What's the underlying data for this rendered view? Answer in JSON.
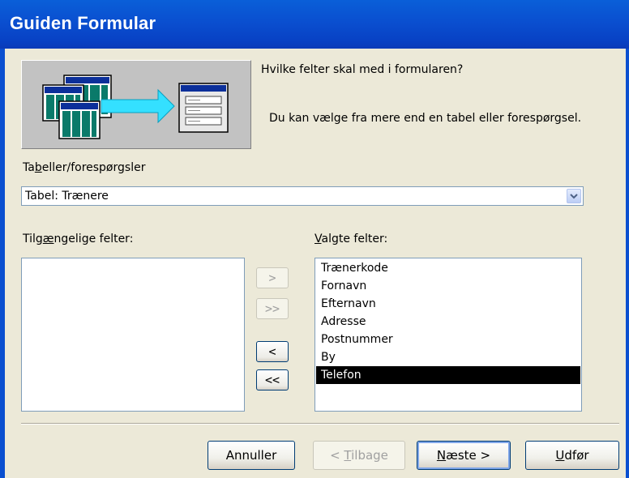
{
  "window": {
    "title": "Guiden Formular"
  },
  "intro": {
    "question": "Hvilke felter skal med i formularen?",
    "hint": "Du kan vælge fra mere end en tabel eller forespørgsel."
  },
  "tables": {
    "label_pre": "Ta",
    "label_accel": "b",
    "label_post": "eller/forespørgsler",
    "selected": "Tabel: Trænere"
  },
  "available": {
    "label_pre": "Tilg",
    "label_accel": "æ",
    "label_post": "ngelige felter:",
    "items": []
  },
  "selected_fields": {
    "label_accel": "V",
    "label_post": "algte felter:",
    "items": [
      "Trænerkode",
      "Fornavn",
      "Efternavn",
      "Adresse",
      "Postnummer",
      "By",
      "Telefon"
    ],
    "highlighted": "Telefon"
  },
  "move_buttons": {
    "add_one": ">",
    "add_all": ">>",
    "remove_one": "<",
    "remove_all": "<<"
  },
  "buttons": {
    "cancel": "Annuller",
    "back_pre": "< ",
    "back_accel": "T",
    "back_post": "ilbage",
    "next_accel": "N",
    "next_post": "æste >",
    "finish_accel": "U",
    "finish_post": "dfør"
  }
}
